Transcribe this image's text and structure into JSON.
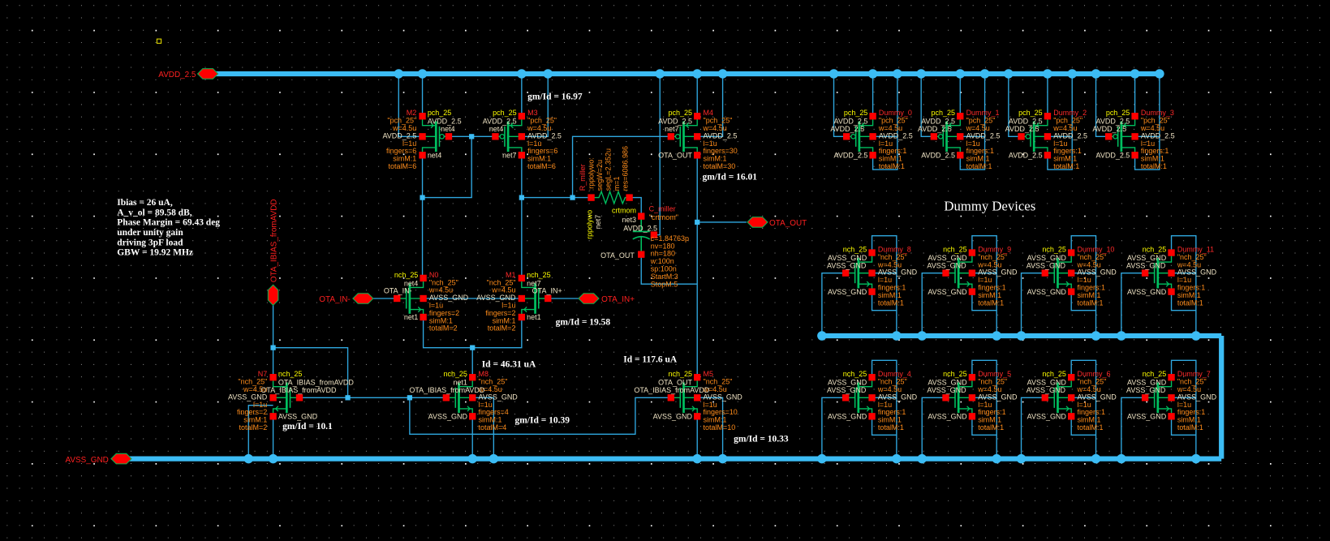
{
  "colors": {
    "background": "#000000",
    "wire": "#2fa8e0",
    "rail": "#3cbcf4",
    "pin": "#ff0000",
    "symbol": "#00c060",
    "instance": "#ff2a2a",
    "model": "#ffff00",
    "param": "#ff8c1a",
    "net_label": "#efe3c4"
  },
  "pins": {
    "avdd": "AVDD_2.5",
    "avss": "AVSS_GND",
    "ibias": "OTA_IBIAS_fromAVDD",
    "in_minus": "OTA_IN-",
    "in_plus": "OTA_IN+",
    "out": "OTA_OUT"
  },
  "annotations": {
    "summary": [
      "Ibias = 26 uA,",
      "A_v_ol = 89.58 dB,",
      "Phase Margin = 69.43 deg",
      "under unity gain",
      "driving 3pF load",
      "GBW = 19.92 MHz"
    ],
    "gm_m2m3": "gm/Id = 16.97",
    "gm_m4": "gm/Id = 16.01",
    "gm_m1": "gm/Id = 19.58",
    "id_tail": "Id = 46.31 uA",
    "id_out": "Id = 117.6 uA",
    "gm_m7": "gm/Id = 10.1",
    "gm_m8": "gm/Id = 10.39",
    "gm_m5": "gm/Id = 10.33",
    "dummy_title": "Dummy Devices"
  },
  "devices": [
    {
      "name": "M2",
      "model": "pch_25",
      "cdf": "\"pch_25\"",
      "w": "w=4.5u",
      "bulk": "AVDD_2.5",
      "l": "l=1u",
      "fingers": "fingers=6",
      "simM": "simM:1",
      "totalM": "totalM=6",
      "d": "AVDD_2.5",
      "g": "net4",
      "s": "net4"
    },
    {
      "name": "M3",
      "model": "pch_25",
      "cdf": "\"pch_25\"",
      "w": "w=4.5u",
      "bulk": "AVDD_2.5",
      "l": "l=1u",
      "fingers": "fingers=6",
      "simM": "simM:1",
      "totalM": "totalM=6",
      "d": "AVDD_2.5",
      "g": "net4",
      "s": "net7"
    },
    {
      "name": "M4",
      "model": "pch_25",
      "cdf": "\"pch_25\"",
      "w": "w=4.5u",
      "bulk": "AVDD_2.5",
      "l": "l=1u",
      "fingers": "fingers=30",
      "simM": "simM:1",
      "totalM": "totalM=30",
      "d": "AVDD_2.5",
      "g": "net7",
      "s": "OTA_OUT"
    },
    {
      "name": "N0",
      "model": "nch_25",
      "cdf": "\"nch_25\"",
      "w": "w=4.5u",
      "bulk": "AVSS_GND",
      "l": "l=1u",
      "fingers": "fingers=2",
      "simM": "simM:1",
      "totalM": "totalM=2",
      "d": "net4",
      "g": "OTA_IN-",
      "s": "net1"
    },
    {
      "name": "M1",
      "model": "nch_25",
      "cdf": "\"nch_25\"",
      "w": "w=4.5u",
      "bulk": "AVSS_GND",
      "l": "l=1u",
      "fingers": "fingers=2",
      "simM": "simM:1",
      "totalM": "totalM=2",
      "d": "net7",
      "g": "OTA_IN+",
      "s": "net1"
    },
    {
      "name": "N7",
      "model": "nch_25",
      "cdf": "\"nch_25\"",
      "w": "w=4.5u",
      "bulk": "AVSS_GND",
      "l": "l=1u",
      "fingers": "fingers=2",
      "simM": "simM:1",
      "totalM": "totalM=2",
      "d": "OTA_IBIAS_fromAVDD",
      "g": "OTA_IBIAS_fromAVDD",
      "s": "AVSS_GND"
    },
    {
      "name": "M8",
      "model": "nch_25",
      "cdf": "\"nch_25\"",
      "w": "w=4.5u",
      "bulk": "AVSS_GND",
      "l": "l=1u",
      "fingers": "fingers=4",
      "simM": "simM:1",
      "totalM": "totalM=4",
      "d": "net1",
      "g": "OTA_IBIAS_fromAVDD",
      "s": "AVSS_GND"
    },
    {
      "name": "M5",
      "model": "nch_25",
      "cdf": "\"nch_25\"",
      "w": "w=4.5u",
      "bulk": "AVSS_GND",
      "l": "l=1u",
      "fingers": "fingers=10",
      "simM": "simM:1",
      "totalM": "totalM=10",
      "d": "OTA_OUT",
      "g": "OTA_IBIAS_fromAVDD",
      "s": "AVSS_GND"
    }
  ],
  "resistor": {
    "name": "R_miller",
    "model": "rppolywo",
    "cdf": ":rppolywo:",
    "segW": "segW=2u",
    "segL": "segL=2.352u",
    "m": "m=1",
    "res": "res=6086.986",
    "net": "net7",
    "net_right": "net3"
  },
  "capacitor": {
    "name": "C_miller",
    "model": "crtmom",
    "cdf": "\"crtmom\"",
    "top": "net3",
    "bulk": "AVDD_2.5",
    "bottom": "OTA_OUT",
    "params": [
      "c=1.84763p",
      "nv=180",
      "nh=180",
      "w:100n",
      "sp:100n",
      "StartM:3",
      "StopM:5"
    ]
  },
  "dummies": [
    {
      "name": "Dummy_0",
      "model": "pch_25",
      "cdf": "\"pch_25\"",
      "w": "w=4.5u",
      "bulk": "AVDD_2.5",
      "l": "l=1u",
      "fingers": "fingers:1",
      "simM": "simM:1",
      "totalM": "totalM:1",
      "d": "AVDD_2.5",
      "g": "AVDD_2.5",
      "s": "AVDD_2.5"
    },
    {
      "name": "Dummy_1",
      "model": "pch_25",
      "cdf": "\"pch_25\"",
      "w": "w=4.5u",
      "bulk": "AVDD_2.5",
      "l": "l=1u",
      "fingers": "fingers:1",
      "simM": "simM:1",
      "totalM": "totalM:1",
      "d": "AVDD_2.5",
      "g": "AVDD_2.5",
      "s": "AVDD_2.5"
    },
    {
      "name": "Dummy_2",
      "model": "pch_25",
      "cdf": "\"pch_25\"",
      "w": "w=4.5u",
      "bulk": "AVDD_2.5",
      "l": "l=1u",
      "fingers": "fingers:1",
      "simM": "simM:1",
      "totalM": "totalM:1",
      "d": "AVDD_2.5",
      "g": "AVDD_2.5",
      "s": "AVDD_2.5"
    },
    {
      "name": "Dummy_3",
      "model": "pch_25",
      "cdf": "\"pch_25\"",
      "w": "w=4.5u",
      "bulk": "AVDD_2.5",
      "l": "l=1u",
      "fingers": "fingers:1",
      "simM": "simM:1",
      "totalM": "totalM:1",
      "d": "AVDD_2.5",
      "g": "AVDD_2.5",
      "s": "AVDD_2.5"
    },
    {
      "name": "Dummy_8",
      "model": "nch_25",
      "cdf": "\"nch_25\"",
      "w": "w=4.5u",
      "bulk": "AVSS_GND",
      "l": "l=1u",
      "fingers": "fingers:1",
      "simM": "simM:1",
      "totalM": "totalM:1",
      "d": "AVSS_GND",
      "g": "AVSS_GND",
      "s": "AVSS_GND"
    },
    {
      "name": "Dummy_9",
      "model": "nch_25",
      "cdf": "\"nch_25\"",
      "w": "w=4.5u",
      "bulk": "AVSS_GND",
      "l": "l=1u",
      "fingers": "fingers:1",
      "simM": "simM:1",
      "totalM": "totalM:1",
      "d": "AVSS_GND",
      "g": "AVSS_GND",
      "s": "AVSS_GND"
    },
    {
      "name": "Dummy_10",
      "model": "nch_25",
      "cdf": "\"nch_25\"",
      "w": "w=4.5u",
      "bulk": "AVSS_GND",
      "l": "l=1u",
      "fingers": "fingers:1",
      "simM": "simM:1",
      "totalM": "totalM:1",
      "d": "AVSS_GND",
      "g": "AVSS_GND",
      "s": "AVSS_GND"
    },
    {
      "name": "Dummy_11",
      "model": "nch_25",
      "cdf": "\"nch_25\"",
      "w": "w=4.5u",
      "bulk": "AVSS_GND",
      "l": "l=1u",
      "fingers": "fingers:1",
      "simM": "simM:1",
      "totalM": "totalM:1",
      "d": "AVSS_GND",
      "g": "AVSS_GND",
      "s": "AVSS_GND"
    },
    {
      "name": "Dummy_4",
      "model": "nch_25",
      "cdf": "\"nch_25\"",
      "w": "w=4.5u",
      "bulk": "AVSS_GND",
      "l": "l=1u",
      "fingers": "fingers:1",
      "simM": "simM:1",
      "totalM": "totalM:1",
      "d": "AVSS_GND",
      "g": "AVSS_GND",
      "s": "AVSS_GND"
    },
    {
      "name": "Dummy_5",
      "model": "nch_25",
      "cdf": "\"nch_25\"",
      "w": "w=4.5u",
      "bulk": "AVSS_GND",
      "l": "l=1u",
      "fingers": "fingers:1",
      "simM": "simM:1",
      "totalM": "totalM:1",
      "d": "AVSS_GND",
      "g": "AVSS_GND",
      "s": "AVSS_GND"
    },
    {
      "name": "Dummy_6",
      "model": "nch_25",
      "cdf": "\"nch_25\"",
      "w": "w=4.5u",
      "bulk": "AVSS_GND",
      "l": "l=1u",
      "fingers": "fingers:1",
      "simM": "simM:1",
      "totalM": "totalM:1",
      "d": "AVSS_GND",
      "g": "AVSS_GND",
      "s": "AVSS_GND"
    },
    {
      "name": "Dummy_7",
      "model": "nch_25",
      "cdf": "\"nch_25\"",
      "w": "w=4.5u",
      "bulk": "AVSS_GND",
      "l": "l=1u",
      "fingers": "fingers:1",
      "simM": "simM:1",
      "totalM": "totalM:1",
      "d": "AVSS_GND",
      "g": "AVSS_GND",
      "s": "AVSS_GND"
    }
  ]
}
